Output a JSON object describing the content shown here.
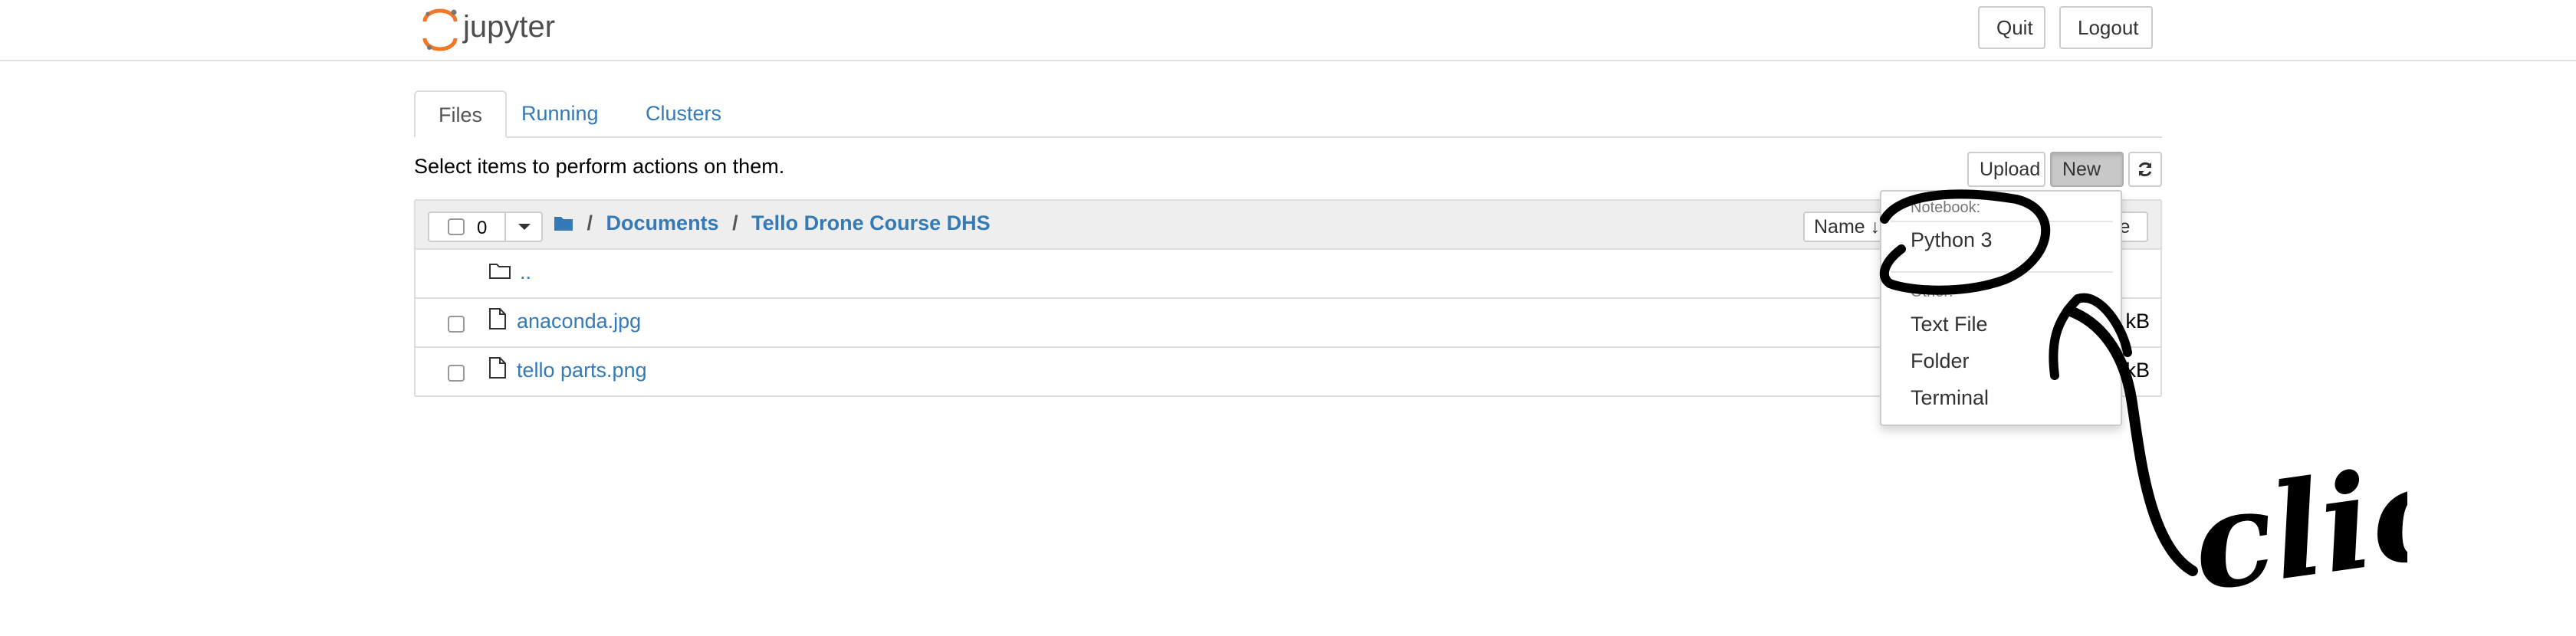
{
  "header": {
    "logo_text": "jupyter",
    "quit_label": "Quit",
    "logout_label": "Logout"
  },
  "tabs": [
    {
      "label": "Files",
      "active": true
    },
    {
      "label": "Running",
      "active": false
    },
    {
      "label": "Clusters",
      "active": false
    }
  ],
  "instructions": "Select items to perform actions on them.",
  "toolbar": {
    "upload_label": "Upload",
    "new_label": "New",
    "refresh_icon": "refresh-icon"
  },
  "list": {
    "selected_count": "0",
    "breadcrumb": {
      "root_icon": "folder-icon",
      "sep": "/",
      "items": [
        "Documents",
        "Tello Drone Course DHS"
      ]
    },
    "sort_name_label": "Name",
    "sort_size_label": "ze",
    "rows": [
      {
        "name": "..",
        "icon": "folder-icon",
        "size": ""
      },
      {
        "name": "anaconda.jpg",
        "icon": "file-icon",
        "size": "kB"
      },
      {
        "name": "tello parts.png",
        "icon": "file-icon",
        "size": "kB"
      }
    ]
  },
  "new_menu": {
    "notebook_header": "Notebook:",
    "notebook_items": [
      "Python 3"
    ],
    "other_header": "Other:",
    "other_items": [
      "Text File",
      "Folder",
      "Terminal"
    ]
  },
  "annotation": {
    "text": "click",
    "color": "#000000"
  },
  "colors": {
    "link": "#337ab7",
    "logo_orange": "#f37726"
  }
}
